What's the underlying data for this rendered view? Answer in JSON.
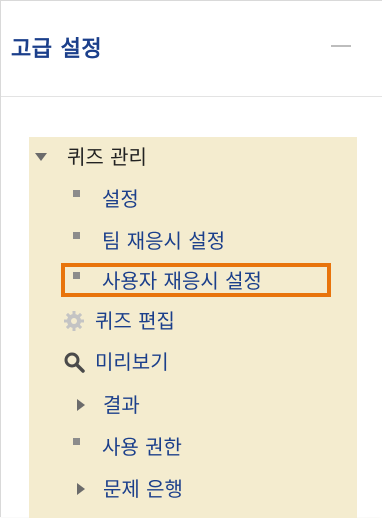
{
  "header": {
    "title": "고급 설정"
  },
  "tree": {
    "root": {
      "label": "퀴즈 관리"
    },
    "items": [
      {
        "label": "설정"
      },
      {
        "label": "팀 재응시 설정"
      },
      {
        "label": "사용자 재응시 설정"
      },
      {
        "label": "퀴즈 편집"
      },
      {
        "label": "미리보기"
      },
      {
        "label": "결과"
      },
      {
        "label": "사용 권한"
      },
      {
        "label": "문제 은행"
      }
    ]
  },
  "colors": {
    "link": "#1b3f8b",
    "tree_background": "#f4eccf",
    "highlight": "#e8740c"
  }
}
